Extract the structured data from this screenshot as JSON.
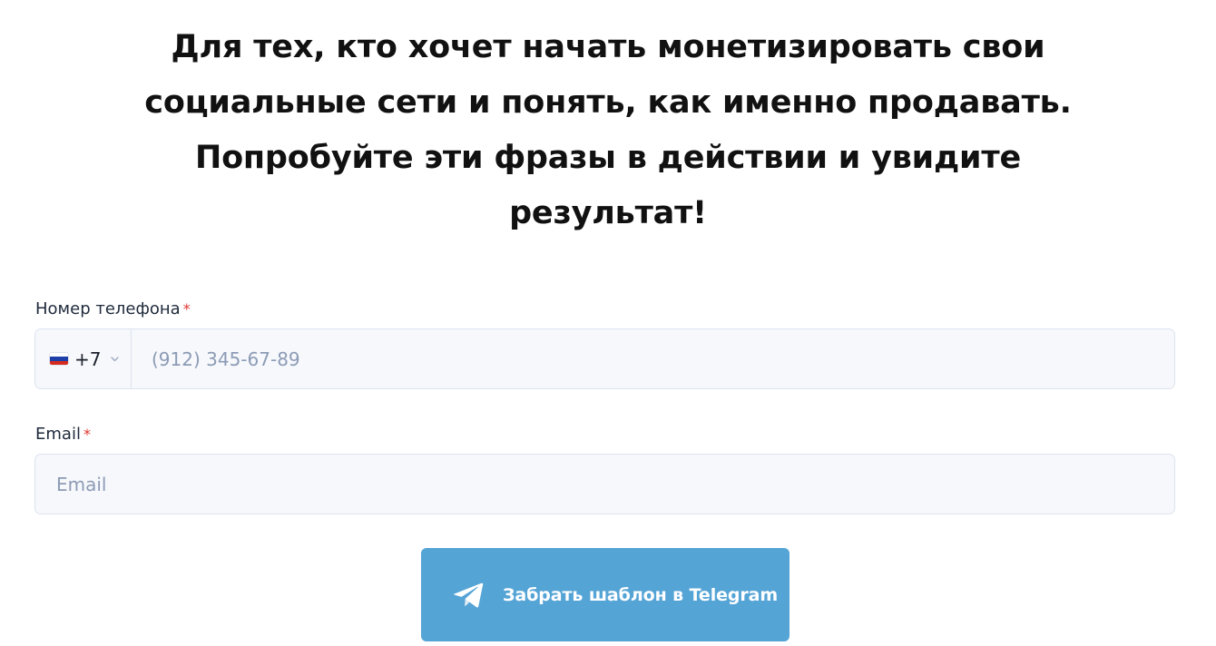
{
  "headline": {
    "lines": [
      "Для тех, кто хочет начать монетизировать свои",
      "социальные сети и понять, как именно продавать.",
      "Попробуйте эти фразы в действии и увидите",
      "результат!"
    ]
  },
  "form": {
    "phone": {
      "label": "Номер телефона",
      "required_mark": "*",
      "country_icon": "russia-flag-icon",
      "dial_code": "+7",
      "placeholder": "(912) 345-67-89",
      "value": ""
    },
    "email": {
      "label": "Email",
      "required_mark": "*",
      "placeholder": "Email",
      "value": ""
    },
    "submit": {
      "icon": "telegram-icon",
      "label": "Забрать шаблон в Telegram"
    }
  },
  "colors": {
    "button": "#55a4d6",
    "required": "#e0342f",
    "field_bg": "#f6f8fc",
    "field_border": "#dde4ee",
    "placeholder": "#8c9bb5"
  }
}
